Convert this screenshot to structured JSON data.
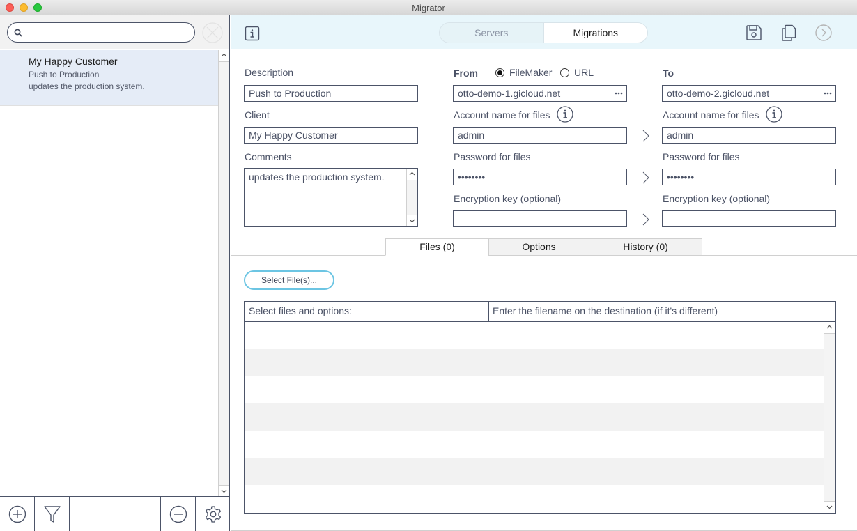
{
  "window": {
    "title": "Migrator"
  },
  "sidebar": {
    "search": {
      "placeholder": "",
      "value": ""
    },
    "items": [
      {
        "title": "My Happy Customer",
        "description": "Push to Production",
        "comments": "updates the production system.",
        "selected": true
      }
    ],
    "bottom_buttons": [
      "add-icon",
      "filter-icon",
      "remove-icon",
      "gear-icon"
    ]
  },
  "toolbar": {
    "segments": [
      {
        "label": "Servers",
        "active": false
      },
      {
        "label": "Migrations",
        "active": true
      }
    ],
    "icons": [
      "info-icon",
      "save-icon",
      "copy-icon",
      "run-icon"
    ]
  },
  "form": {
    "description_label": "Description",
    "description_value": "Push to Production",
    "client_label": "Client",
    "client_value": "My Happy Customer",
    "comments_label": "Comments",
    "comments_value": "updates the production system.",
    "from": {
      "label": "From",
      "source_options": [
        {
          "label": "FileMaker",
          "selected": true
        },
        {
          "label": "URL",
          "selected": false
        }
      ],
      "server": "otto-demo-1.gicloud.net",
      "account_label": "Account name for files",
      "account_value": "admin",
      "password_label": "Password for files",
      "password_value": "••••••••",
      "encryption_label": "Encryption key (optional)",
      "encryption_value": ""
    },
    "to": {
      "label": "To",
      "server": "otto-demo-2.gicloud.net",
      "account_label": "Account name for files",
      "account_value": "admin",
      "password_label": "Password for files",
      "password_value": "••••••••",
      "encryption_label": "Encryption key (optional)",
      "encryption_value": ""
    }
  },
  "tabs": [
    {
      "label": "Files (0)",
      "active": true
    },
    {
      "label": "Options",
      "active": false
    },
    {
      "label": "History (0)",
      "active": false
    }
  ],
  "files": {
    "select_button": "Select File(s)...",
    "columns": [
      "Select files and options:",
      "Enter the filename on the destination (if it's different)"
    ],
    "rows": []
  },
  "colors": {
    "toolbar_bg": "#e8f6fb",
    "selected_row_bg": "#e5ecf7",
    "accent_button_border": "#6cc5e3",
    "border": "#4c5468"
  }
}
